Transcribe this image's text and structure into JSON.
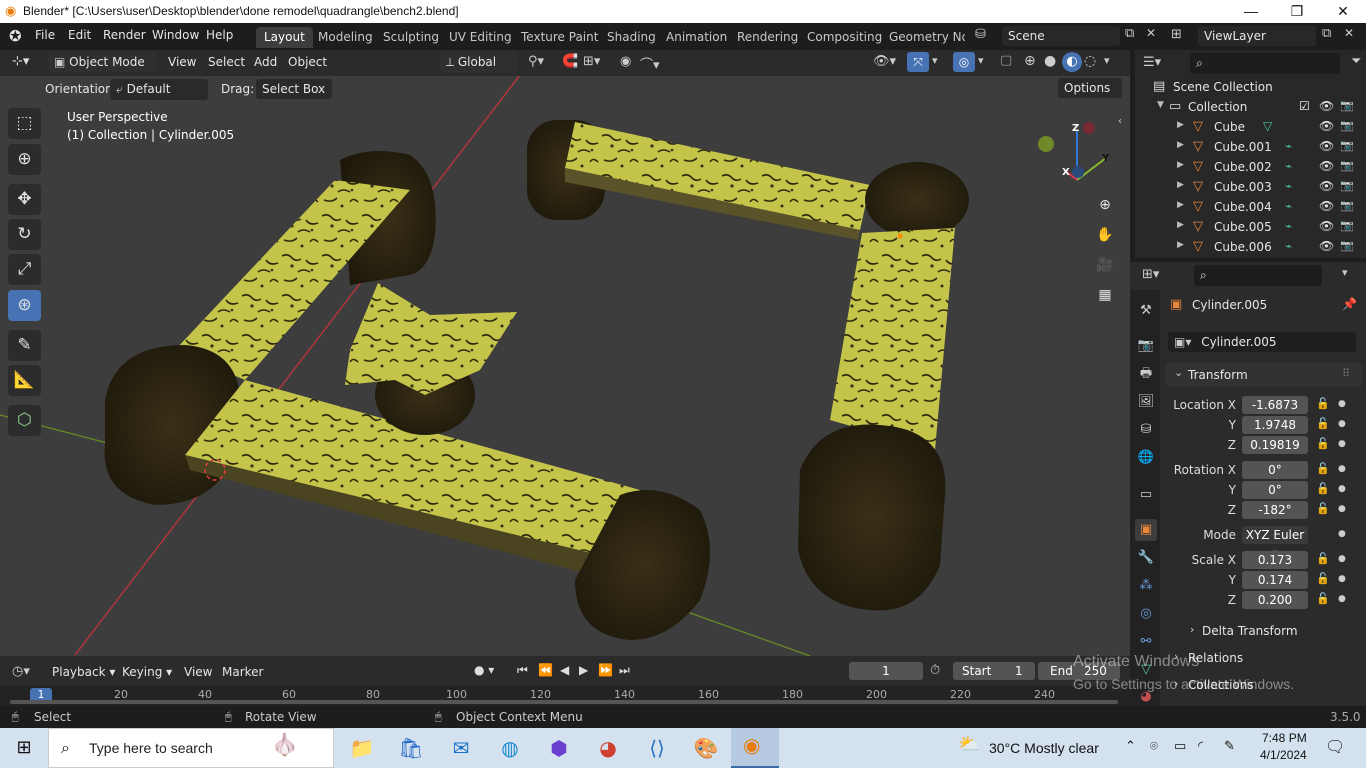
{
  "window": {
    "title": "Blender* [C:\\Users\\user\\Desktop\\blender\\done remodel\\quadrangle\\bench2.blend]",
    "minimize": "—",
    "maximize": "❐",
    "close": "✕"
  },
  "menu": {
    "file": "File",
    "edit": "Edit",
    "render": "Render",
    "window": "Window",
    "help": "Help"
  },
  "workspaces": [
    "Layout",
    "Modeling",
    "Sculpting",
    "UV Editing",
    "Texture Paint",
    "Shading",
    "Animation",
    "Rendering",
    "Compositing",
    "Geometry Noc"
  ],
  "scene": {
    "name": "Scene",
    "viewlayer": "ViewLayer"
  },
  "viewport_header": {
    "mode": "Object Mode",
    "view": "View",
    "select": "Select",
    "add": "Add",
    "object": "Object",
    "transform_space": "Global",
    "orientation_label": "Orientation:",
    "orientation_value": "Default",
    "drag_label": "Drag:",
    "drag_value": "Select Box",
    "options": "Options"
  },
  "viewport_info": {
    "perspective": "User Perspective",
    "context": "(1) Collection | Cylinder.005"
  },
  "gizmo": {
    "x": "X",
    "y": "Y",
    "z": "Z"
  },
  "outliner": {
    "root": "Scene Collection",
    "collection": "Collection",
    "items": [
      "Cube",
      "Cube.001",
      "Cube.002",
      "Cube.003",
      "Cube.004",
      "Cube.005",
      "Cube.006"
    ]
  },
  "properties": {
    "object_name": "Cylinder.005",
    "datablock": "Cylinder.005",
    "transform_title": "Transform",
    "location_x_label": "Location X",
    "location_x": "-1.6873",
    "location_y_label": "Y",
    "location_y": "1.9748",
    "location_z_label": "Z",
    "location_z": "0.19819",
    "rotation_x_label": "Rotation X",
    "rotation_x": "0°",
    "rotation_y_label": "Y",
    "rotation_y": "0°",
    "rotation_z_label": "Z",
    "rotation_z": "-182°",
    "mode_label": "Mode",
    "mode_value": "XYZ Euler",
    "scale_x_label": "Scale X",
    "scale_x": "0.173",
    "scale_y_label": "Y",
    "scale_y": "0.174",
    "scale_z_label": "Z",
    "scale_z": "0.200",
    "delta": "Delta Transform",
    "relations": "Relations",
    "collections": "Collections"
  },
  "timeline": {
    "playback": "Playback",
    "keying": "Keying",
    "view": "View",
    "marker": "Marker",
    "current_frame": "1",
    "start_label": "Start",
    "start": "1",
    "end_label": "End",
    "end": "250",
    "ticks": [
      "1",
      "20",
      "40",
      "60",
      "80",
      "100",
      "120",
      "140",
      "160",
      "180",
      "200",
      "220",
      "240"
    ]
  },
  "statusbar": {
    "select": "Select",
    "rotate": "Rotate View",
    "context": "Object Context Menu",
    "version": "3.5.0"
  },
  "watermark": {
    "line1": "Activate Windows",
    "line2": "Go to Settings to activate Windows."
  },
  "taskbar": {
    "search_placeholder": "Type here to search",
    "weather": "30°C  Mostly clear",
    "time": "7:48 PM",
    "date": "4/1/2024"
  },
  "colors": {
    "accent": "#4772b3",
    "bench_top": "#c8c84a",
    "bench_dark": "#2e2612"
  }
}
